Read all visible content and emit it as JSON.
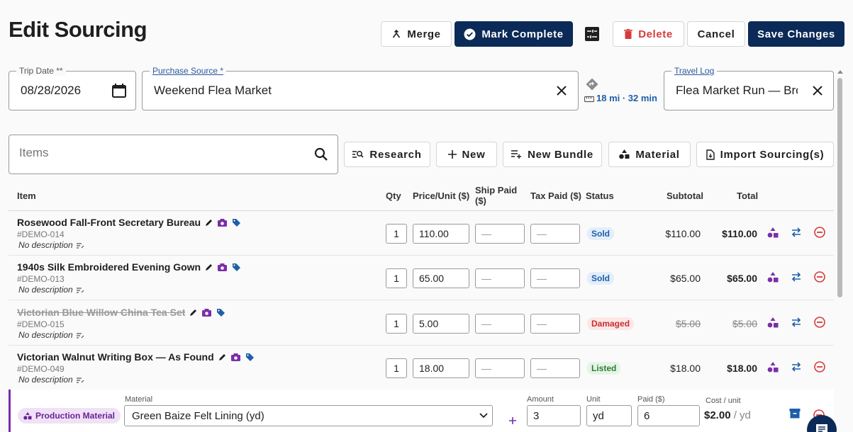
{
  "header": {
    "title": "Edit Sourcing",
    "merge_label": "Merge",
    "mark_complete_label": "Mark Complete",
    "delete_label": "Delete",
    "cancel_label": "Cancel",
    "save_label": "Save Changes"
  },
  "trip": {
    "trip_date_label": "Trip Date **",
    "trip_date_value": "08/28/2026",
    "purchase_source_label": "Purchase Source *",
    "purchase_source_value": "Weekend Flea Market",
    "route_text": "18 mi · 32 min",
    "travel_log_label": "Travel Log",
    "travel_log_value": "Flea Market Run — Bro"
  },
  "toolbar": {
    "search_placeholder": "Items",
    "research_label": "Research",
    "new_label": "New",
    "new_bundle_label": "New Bundle",
    "material_label": "Material",
    "import_label": "Import Sourcing(s)"
  },
  "table": {
    "headers": {
      "item": "Item",
      "qty": "Qty",
      "price": "Price/Unit ($)",
      "ship_line1": "Ship Paid",
      "ship_line2": "($)",
      "tax": "Tax Paid ($)",
      "status": "Status",
      "subtotal": "Subtotal",
      "total": "Total"
    },
    "rows": [
      {
        "name": "Rosewood Fall-Front Secretary Bureau",
        "sku": "#DEMO-014",
        "desc": "No description",
        "qty": "1",
        "price": "110.00",
        "ship": "—",
        "tax": "—",
        "status": "Sold",
        "subtotal": "$110.00",
        "total": "$110.00"
      },
      {
        "name": "1940s Silk Embroidered Evening Gown",
        "sku": "#DEMO-013",
        "desc": "No description",
        "qty": "1",
        "price": "65.00",
        "ship": "—",
        "tax": "—",
        "status": "Sold",
        "subtotal": "$65.00",
        "total": "$65.00"
      },
      {
        "name": "Victorian Blue Willow China Tea Set",
        "sku": "#DEMO-015",
        "desc": "No description",
        "qty": "1",
        "price": "5.00",
        "ship": "—",
        "tax": "—",
        "status": "Damaged",
        "subtotal": "$5.00",
        "total": "$5.00"
      },
      {
        "name": "Victorian Walnut Writing Box — As Found",
        "sku": "#DEMO-049",
        "desc": "No description",
        "qty": "1",
        "price": "18.00",
        "ship": "—",
        "tax": "—",
        "status": "Listed",
        "subtotal": "$18.00",
        "total": "$18.00"
      }
    ]
  },
  "material_row": {
    "chip": "Production Material",
    "material_label": "Material",
    "material_value": "Green Baize Felt Lining (yd)",
    "amount_label": "Amount",
    "amount_value": "3",
    "unit_label": "Unit",
    "unit_value": "yd",
    "paid_label": "Paid ($)",
    "paid_value": "6",
    "cost_label": "Cost / unit",
    "cost_value": "$2.00",
    "cost_suffix": "/ yd"
  },
  "colors": {
    "primary": "#0b2a57",
    "danger": "#d73a3a",
    "material": "#7b2ea8",
    "link": "#1d5fa8"
  }
}
